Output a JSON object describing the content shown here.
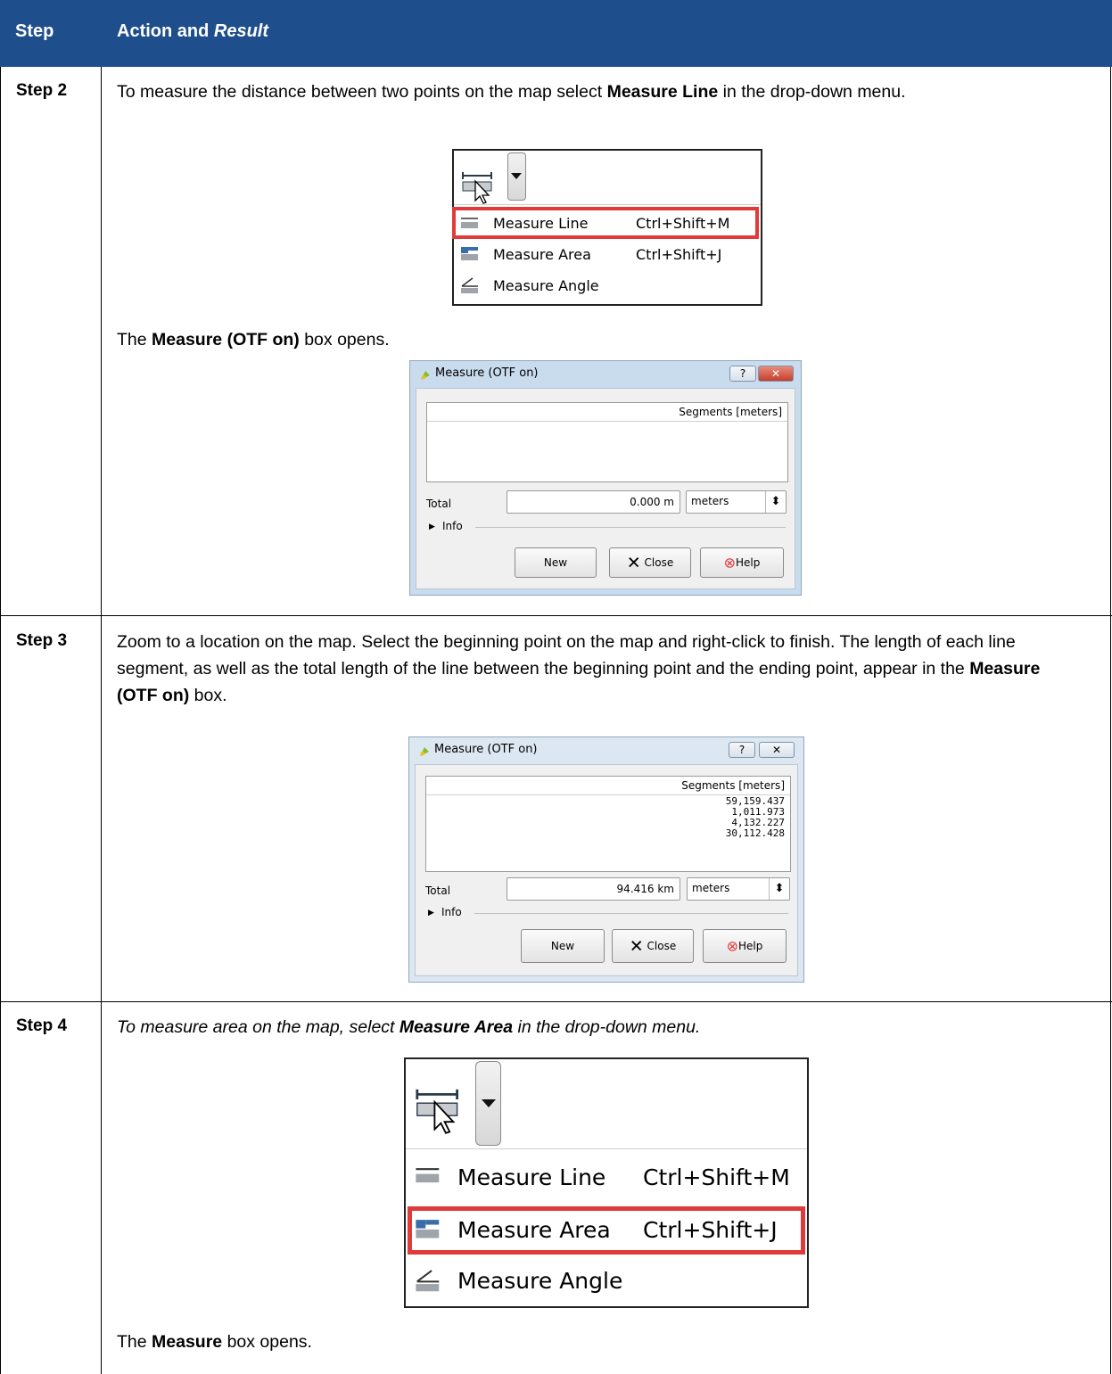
{
  "header": {
    "col1": "Step",
    "col2_prefix": "Action and ",
    "col2_italic": "Result"
  },
  "rows": [
    {
      "step": "Step 2",
      "text1": "To measure the distance between two points on the map select ",
      "bold1": "Measure Line",
      "text2": " in the drop-down menu.",
      "menu": {
        "items": [
          {
            "label": "Measure Line",
            "shortcut": "Ctrl+Shift+M",
            "icon": "measure-line-icon"
          },
          {
            "label": "Measure Area",
            "shortcut": "Ctrl+Shift+J",
            "icon": "measure-area-icon"
          },
          {
            "label": "Measure Angle",
            "shortcut": "",
            "icon": "measure-angle-icon"
          }
        ]
      },
      "after_pre": "The ",
      "after_bold": "Measure (OTF on)",
      "after_post": " box opens.",
      "dialog": {
        "title": "Measure (OTF on)",
        "column_header": "Segments [meters]",
        "segments": [],
        "total_label": "Total",
        "total_value": "0.000 m",
        "unit": "meters",
        "info_label": "Info",
        "buttons": {
          "new": "New",
          "close": "Close",
          "help": "Help"
        }
      }
    },
    {
      "step": "Step 3",
      "text1": "Zoom to a location on the map. Select the beginning point on the map and right-click to finish. The length of each line segment, as well as the total length of the line between the beginning point and the ending point, appear in the ",
      "bold1": "Measure (OTF on)",
      "text2": " box.",
      "dialog": {
        "title": "Measure (OTF on)",
        "column_header": "Segments [meters]",
        "segments": [
          "59,159.437",
          "1,011.973",
          "4,132.227",
          "30,112.428"
        ],
        "total_label": "Total",
        "total_value": "94.416 km",
        "unit": "meters",
        "info_label": "Info",
        "buttons": {
          "new": "New",
          "close": "Close",
          "help": "Help"
        }
      }
    },
    {
      "step": "Step 4",
      "text1": "To measure area on the map, select ",
      "bold1": "Measure Area",
      "text2": " in the drop-down menu.",
      "menu": {
        "items": [
          {
            "label": "Measure Line",
            "shortcut": "Ctrl+Shift+M",
            "icon": "measure-line-icon"
          },
          {
            "label": "Measure Area",
            "shortcut": "Ctrl+Shift+J",
            "icon": "measure-area-icon"
          },
          {
            "label": "Measure Angle",
            "shortcut": "",
            "icon": "measure-angle-icon"
          }
        ]
      },
      "after_pre": "The ",
      "after_bold": "Measure",
      "after_post": " box opens."
    }
  ],
  "colors": {
    "header_bg": "#1f4e8c",
    "highlight": "#e03a3a"
  }
}
